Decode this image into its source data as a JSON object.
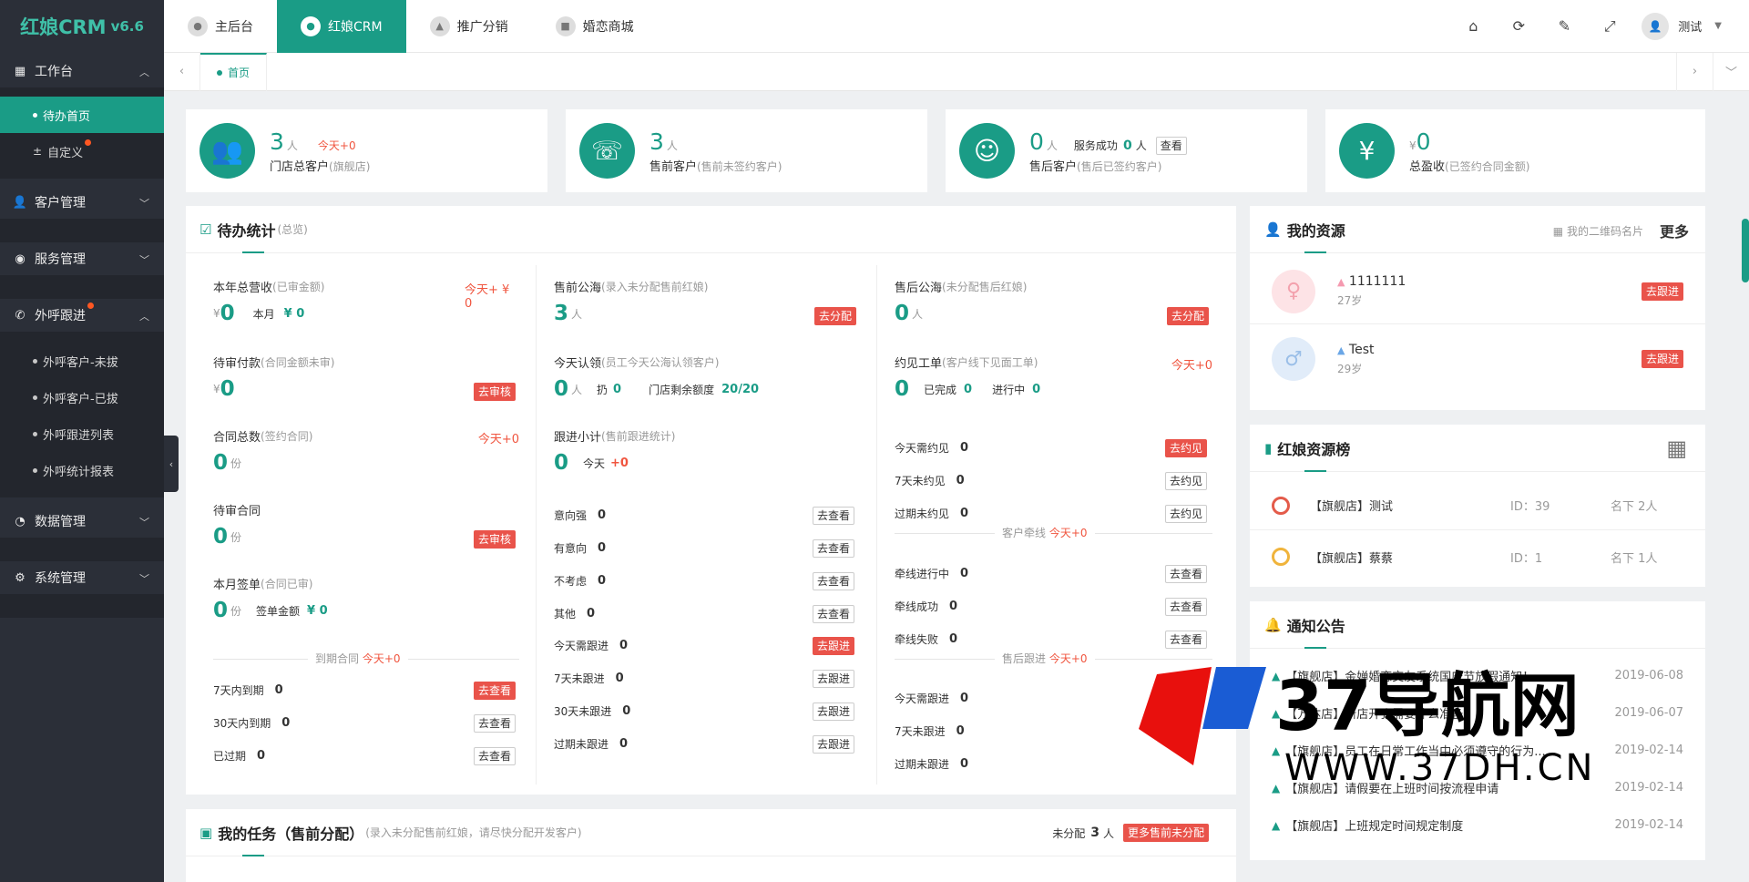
{
  "app": {
    "name": "红娘CRM",
    "version": "v6.6"
  },
  "sidebar": {
    "groups": [
      {
        "label": "工作台",
        "icon": "dashboard-icon",
        "expanded": true,
        "items": [
          {
            "label": "待办首页",
            "active": true
          },
          {
            "label": "自定义",
            "badge": true
          }
        ]
      },
      {
        "label": "客户管理",
        "icon": "user-icon"
      },
      {
        "label": "服务管理",
        "icon": "service-icon"
      },
      {
        "label": "外呼跟进",
        "icon": "phone-icon",
        "expanded": true,
        "badge": true,
        "items": [
          {
            "label": "外呼客户-未拔"
          },
          {
            "label": "外呼客户-已拔"
          },
          {
            "label": "外呼跟进列表"
          },
          {
            "label": "外呼统计报表"
          }
        ]
      },
      {
        "label": "数据管理",
        "icon": "data-icon"
      },
      {
        "label": "系统管理",
        "icon": "gear-icon"
      }
    ]
  },
  "topnav": [
    {
      "label": "主后台"
    },
    {
      "label": "红娘CRM",
      "active": true
    },
    {
      "label": "推广分销"
    },
    {
      "label": "婚恋商城"
    }
  ],
  "user": {
    "name": "测试"
  },
  "tabs": {
    "home": "首页"
  },
  "stats": [
    {
      "value": "3",
      "unit": "人",
      "extra": "今天+0",
      "label": "门店总客户",
      "note": "(旗舰店)"
    },
    {
      "value": "3",
      "unit": "人",
      "label": "售前客户",
      "note": "(售前未签约客户)"
    },
    {
      "value": "0",
      "unit": "人",
      "extra_label": "服务成功",
      "extra_value": "0",
      "extra_unit": "人",
      "button": "查看",
      "label": "售后客户",
      "note": "(售后已签约客户)"
    },
    {
      "prefix": "¥",
      "value": "0",
      "label": "总盈收",
      "note": "(已签约合同金额)"
    }
  ],
  "todo": {
    "title": "待办统计",
    "subtitle": "(总览)",
    "col1": {
      "annual": {
        "label": "本年总营收",
        "note": "(已审金额)",
        "today": "今天+ ¥ 0",
        "cur": "¥",
        "value": "0",
        "month_label": "本月",
        "month_value": "¥ 0"
      },
      "pay": {
        "label": "待审付款",
        "note": "(合同金额未审)",
        "cur": "¥",
        "value": "0",
        "button": "去审核"
      },
      "contracts": {
        "label": "合同总数",
        "note": "(签约合同)",
        "today": "今天+0",
        "value": "0",
        "unit": "份"
      },
      "pending": {
        "label": "待审合同",
        "value": "0",
        "unit": "份",
        "button": "去审核"
      },
      "monthsign": {
        "label": "本月签单",
        "note": "(合同已审)",
        "value": "0",
        "unit": "份",
        "amount_label": "签单金额",
        "amount_value": "¥ 0"
      },
      "expire": {
        "label": "到期合同",
        "today": "今天+0",
        "rows": [
          {
            "label": "7天内到期",
            "value": "0",
            "button": "去查看",
            "red": true
          },
          {
            "label": "30天内到期",
            "value": "0",
            "button": "去查看"
          },
          {
            "label": "已过期",
            "value": "0",
            "button": "去查看"
          }
        ]
      }
    },
    "col2": {
      "presea": {
        "label": "售前公海",
        "note": "(录入未分配售前红娘)",
        "value": "3",
        "unit": "人",
        "button": "去分配"
      },
      "claim": {
        "label": "今天认领",
        "note": "(员工今天公海认领客户)",
        "value": "0",
        "unit": "人",
        "throw_label": "扔",
        "throw_value": "0",
        "quota_label": "门店剩余额度",
        "quota_value": "20/20"
      },
      "follow": {
        "label": "跟进小计",
        "note": "(售前跟进统计)",
        "value": "0",
        "today_label": "今天",
        "today_value": "+0"
      },
      "rows": [
        {
          "label": "意向强",
          "value": "0",
          "button": "去查看"
        },
        {
          "label": "有意向",
          "value": "0",
          "button": "去查看"
        },
        {
          "label": "不考虑",
          "value": "0",
          "button": "去查看"
        },
        {
          "label": "其他",
          "value": "0",
          "button": "去查看"
        },
        {
          "label": "今天需跟进",
          "value": "0",
          "button": "去跟进",
          "red": true
        },
        {
          "label": "7天未跟进",
          "value": "0",
          "button": "去跟进"
        },
        {
          "label": "30天未跟进",
          "value": "0",
          "button": "去跟进"
        },
        {
          "label": "过期未跟进",
          "value": "0",
          "button": "去跟进"
        }
      ]
    },
    "col3": {
      "postsea": {
        "label": "售后公海",
        "note": "(未分配售后红娘)",
        "value": "0",
        "unit": "人",
        "button": "去分配"
      },
      "appoint": {
        "label": "约见工单",
        "note": "(客户线下见面工单)",
        "today": "今天+0",
        "value": "0",
        "done_label": "已完成",
        "done_value": "0",
        "doing_label": "进行中",
        "doing_value": "0"
      },
      "appoint_rows": [
        {
          "label": "今天需约见",
          "value": "0",
          "button": "去约见",
          "red": true
        },
        {
          "label": "7天未约见",
          "value": "0",
          "button": "去约见"
        },
        {
          "label": "过期未约见",
          "value": "0",
          "button": "去约见"
        }
      ],
      "match": {
        "label": "客户牵线",
        "today": "今天+0",
        "rows": [
          {
            "label": "牵线进行中",
            "value": "0",
            "button": "去查看"
          },
          {
            "label": "牵线成功",
            "value": "0",
            "button": "去查看"
          },
          {
            "label": "牵线失败",
            "value": "0",
            "button": "去查看"
          }
        ]
      },
      "after": {
        "label": "售后跟进",
        "today": "今天+0",
        "rows": [
          {
            "label": "今天需跟进",
            "value": "0",
            "red": true
          },
          {
            "label": "7天未跟进",
            "value": "0"
          },
          {
            "label": "过期未跟进",
            "value": "0"
          }
        ]
      }
    }
  },
  "resources": {
    "title": "我的资源",
    "qr_label": "我的二维码名片",
    "more": "更多",
    "items": [
      {
        "name": "1111111",
        "age": "27岁",
        "button": "去跟进",
        "gender": "female"
      },
      {
        "name": "Test",
        "age": "29岁",
        "button": "去跟进",
        "gender": "male"
      }
    ]
  },
  "ranking": {
    "title": "红娘资源榜",
    "items": [
      {
        "name": "【旗舰店】测试",
        "id": "ID：39",
        "count": "名下 2人",
        "medal": "#e45b4a"
      },
      {
        "name": "【旗舰店】蔡蔡",
        "id": "ID：1",
        "count": "名下 1人",
        "medal": "#f0b43c"
      }
    ]
  },
  "notices": {
    "title": "通知公告",
    "items": [
      {
        "text": "【旗舰店】金婵婚恋交友系统国庆节放假通知！",
        "date": "2019-06-08"
      },
      {
        "text": "【万达店】新店开张需要什么准备",
        "date": "2019-06-07"
      },
      {
        "text": "【旗舰店】员工在日常工作当中必须遵守的行为...",
        "date": "2019-02-14"
      },
      {
        "text": "【旗舰店】请假要在上班时间按流程申请",
        "date": "2019-02-14"
      },
      {
        "text": "【旗舰店】上班规定时间规定制度",
        "date": "2019-02-14"
      }
    ]
  },
  "tasks": {
    "title": "我的任务（售前分配）",
    "note": "(录入未分配售前红娘，请尽快分配开发客户)",
    "unassigned_label": "未分配",
    "unassigned_value": "3",
    "unassigned_unit": "人",
    "button": "更多售前未分配"
  },
  "watermark": {
    "text": "37导航网",
    "url": "WWW.37DH.CN"
  },
  "colors": {
    "primary": "#1a9c86",
    "sidebar": "#2b2f38",
    "red": "#e9534a"
  }
}
